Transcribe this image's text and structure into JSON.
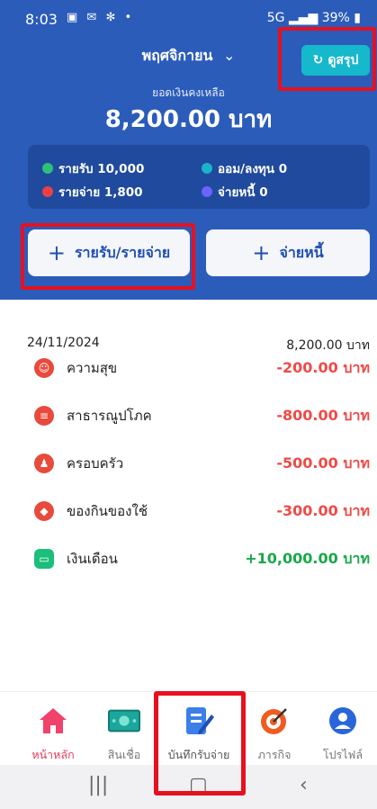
{
  "status_bar": {
    "time": "8:03",
    "battery": "39%"
  },
  "header": {
    "month": "พฤศจิกายน",
    "summary_button": "ดูสรุป",
    "balance_label": "ยอดเงินคงเหลือ",
    "balance_amount": "8,200.00 บาท"
  },
  "stats": {
    "income": "รายรับ 10,000",
    "saving": "ออม/ลงทุน 0",
    "expense": "รายจ่าย 1,800",
    "debt": "จ่ายหนี้ 0",
    "colors": {
      "income": "#2fc07a",
      "saving": "#1bb3c9",
      "expense": "#ee3f46",
      "debt": "#6c63ff"
    }
  },
  "actions": {
    "add_income_expense": "รายรับ/รายจ่าย",
    "pay_debt": "จ่ายหนี้"
  },
  "day": {
    "date": "24/11/2024",
    "total": "8,200.00 บาท"
  },
  "transactions": [
    {
      "icon": "smile-icon",
      "name": "ความสุข",
      "amount": "-200.00 บาท"
    },
    {
      "icon": "bill-icon",
      "name": "สาธารณูปโภค",
      "amount": "-800.00 บาท"
    },
    {
      "icon": "family-icon",
      "name": "ครอบครัว",
      "amount": "-500.00 บาท"
    },
    {
      "icon": "grocery-icon",
      "name": "ของกินของใช้",
      "amount": "-300.00 บาท"
    },
    {
      "icon": "wallet-icon",
      "name": "เงินเดือน",
      "amount": "+10,000.00 บาท"
    }
  ],
  "bottom_nav": [
    {
      "icon": "home-icon",
      "label": "หน้าหลัก",
      "active": true
    },
    {
      "icon": "banknote-icon",
      "label": "สินเชื่อ",
      "active": false
    },
    {
      "icon": "notebook-icon",
      "label": "บันทึกรับจ่าย",
      "active": false
    },
    {
      "icon": "target-icon",
      "label": "ภารกิจ",
      "active": false
    },
    {
      "icon": "profile-icon",
      "label": "โปรไฟล์",
      "active": false
    }
  ],
  "colors": {
    "header_bg": "#2b5cba",
    "accent_red": "#e84a3c",
    "income_green": "#18a84a",
    "highlight": "#e8101f"
  }
}
